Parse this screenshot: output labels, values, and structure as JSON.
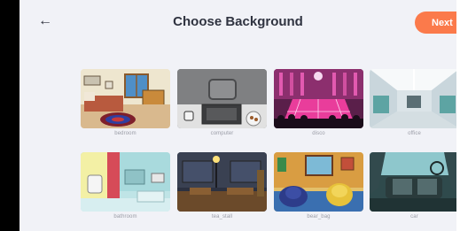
{
  "header": {
    "back_icon": "arrow-left-icon",
    "back_glyph": "←",
    "title": "Choose Background",
    "next_label": "Next"
  },
  "colors": {
    "accent": "#fb7a4b",
    "screen_bg": "#f1f2f7",
    "title": "#2f3340",
    "caption": "#9a9ca6"
  },
  "backgrounds": [
    {
      "label": "bedroom"
    },
    {
      "label": "computer"
    },
    {
      "label": "disco"
    },
    {
      "label": "office"
    },
    {
      "label": "bathroom"
    },
    {
      "label": "tea_stall"
    },
    {
      "label": "bear_bag"
    },
    {
      "label": "car"
    }
  ]
}
